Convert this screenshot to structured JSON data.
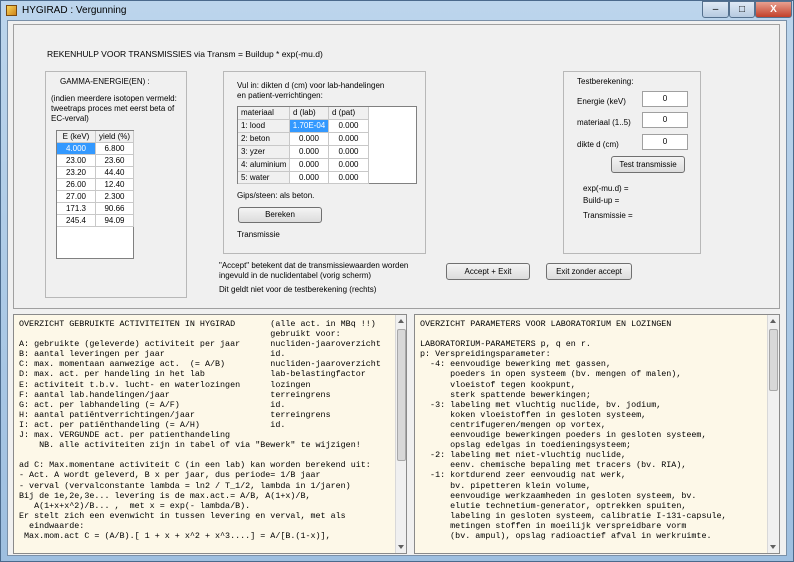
{
  "window": {
    "title": "HYGIRAD : Vergunning",
    "close_label": "X"
  },
  "heading": "REKENHULP VOOR TRANSMISSIES via Transm = Buildup * exp(-mu.d)",
  "gamma": {
    "title": "GAMMA-ENERGIE(EN) :",
    "note": [
      "(indien meerdere isotopen vermeld:",
      "tweetraps proces met eerst beta of",
      "EC-verval)"
    ],
    "columns": [
      "E (keV)",
      "yield (%)"
    ],
    "rows": [
      [
        "4.000",
        "6.800"
      ],
      [
        "23.00",
        "23.60"
      ],
      [
        "23.20",
        "44.40"
      ],
      [
        "26.00",
        "12.40"
      ],
      [
        "27.00",
        "2.300"
      ],
      [
        "171.3",
        "90.66"
      ],
      [
        "245.4",
        "94.09"
      ]
    ]
  },
  "materials": {
    "intro": [
      "Vul in: dikten d (cm) voor lab-handelingen",
      "en patient-verrichtingen:"
    ],
    "columns": [
      "materiaal",
      "d (lab)",
      "d (pat)"
    ],
    "rows": [
      [
        "1: lood",
        "1.70E-04",
        "0.000"
      ],
      [
        "2: beton",
        "0.000",
        "0.000"
      ],
      [
        "3: yzer",
        "0.000",
        "0.000"
      ],
      [
        "4: aluminium",
        "0.000",
        "0.000"
      ],
      [
        "5: water",
        "0.000",
        "0.000"
      ]
    ],
    "gips_note": "Gips/steen: als beton.",
    "compute_button": "Bereken",
    "result_label": "Transmissie"
  },
  "test": {
    "title": "Testberekening:",
    "energy_label": "Energie (keV)",
    "energy_value": "0",
    "material_label": "materiaal (1..5)",
    "material_value": "0",
    "thickness_label": "dikte d (cm)",
    "thickness_value": "0",
    "button": "Test transmissie",
    "outputs": [
      "exp(-mu.d) =",
      "Build-up =",
      "Transmissie ="
    ]
  },
  "footer": {
    "accept_note": [
      "\"Accept\" betekent dat de transmissiewaarden worden",
      "ingevuld in de nuclidentabel (vorig scherm)"
    ],
    "accept_exit": "Accept + Exit",
    "exit_no_accept": "Exit zonder accept",
    "test_note": "Dit geldt niet voor de testberekening (rechts)"
  },
  "activities_text": "OVERZICHT GEBRUIKTE ACTIVITEITEN IN HYGIRAD       (alle act. in MBq !!)\n                                                  gebruikt voor:\nA: gebruikte (geleverde) activiteit per jaar      nucliden-jaaroverzicht\nB: aantal leveringen per jaar                     id.\nC: max. momentaan aanwezige act.  (= A/B)         nucliden-jaaroverzicht\nD: max. act. per handeling in het lab             lab-belastingfactor\nE: activiteit t.b.v. lucht- en waterlozingen      lozingen\nF: aantal lab.handelingen/jaar                    terreingrens\nG: act. per labhandeling (= A/F)                  id.\nH: aantal patiëntverrichtingen/jaar               terreingrens\nI: act. per patiënthandeling (= A/H)              id.\nJ: max. VERGUNDE act. per patienthandeling\n    NB. alle activiteiten zijn in tabel of via \"Bewerk\" te wijzigen!\n\nad C: Max.momentane activiteit C (in een lab) kan worden berekend uit:\n- Act. A wordt geleverd, B x per jaar, dus periode= 1/B jaar\n- verval (vervalconstante lambda = ln2 / T_1/2, lambda in 1/jaren)\nBij de 1e,2e,3e... levering is de max.act.= A/B, A(1+x)/B,\n   A(1+x+x^2)/B... ,  met x = exp(- lambda/B).\nEr stelt zich een evenwicht in tussen levering en verval, met als\n  eindwaarde:\n Max.mom.act C = (A/B).[ 1 + x + x^2 + x^3....] = A/[B.(1-x)],",
  "parameters_text": "OVERZICHT PARAMETERS VOOR LABORATORIUM EN LOZINGEN\n\nLABORATORIUM-PARAMETERS p, q en r.\np: Verspreidingsparameter:\n  -4: eenvoudige bewerking met gassen,\n      poeders in open systeem (bv. mengen of malen),\n      vloeistof tegen kookpunt,\n      sterk spattende bewerkingen;\n  -3: labeling met vluchtig nuclide, bv. jodium,\n      koken vloeistoffen in gesloten systeem,\n      centrifugeren/mengen op vortex,\n      eenvoudige bewerkingen poeders in gesloten systeem,\n      opslag edelgas in toedieningsysteem;\n  -2: labeling met niet-vluchtig nuclide,\n      eenv. chemische bepaling met tracers (bv. RIA),\n  -1: kortdurend zeer eenvoudig nat werk,\n      bv. pipetteren klein volume,\n      eenvoudige werkzaamheden in gesloten systeem, bv.\n      elutie technetium-generator, optrekken spuiten,\n      labeling in gesloten systeem, calibratie I-131-capsule,\n      metingen stoffen in moeilijk verspreidbare vorm\n      (bv. ampul), opslag radioactief afval in werkruimte."
}
